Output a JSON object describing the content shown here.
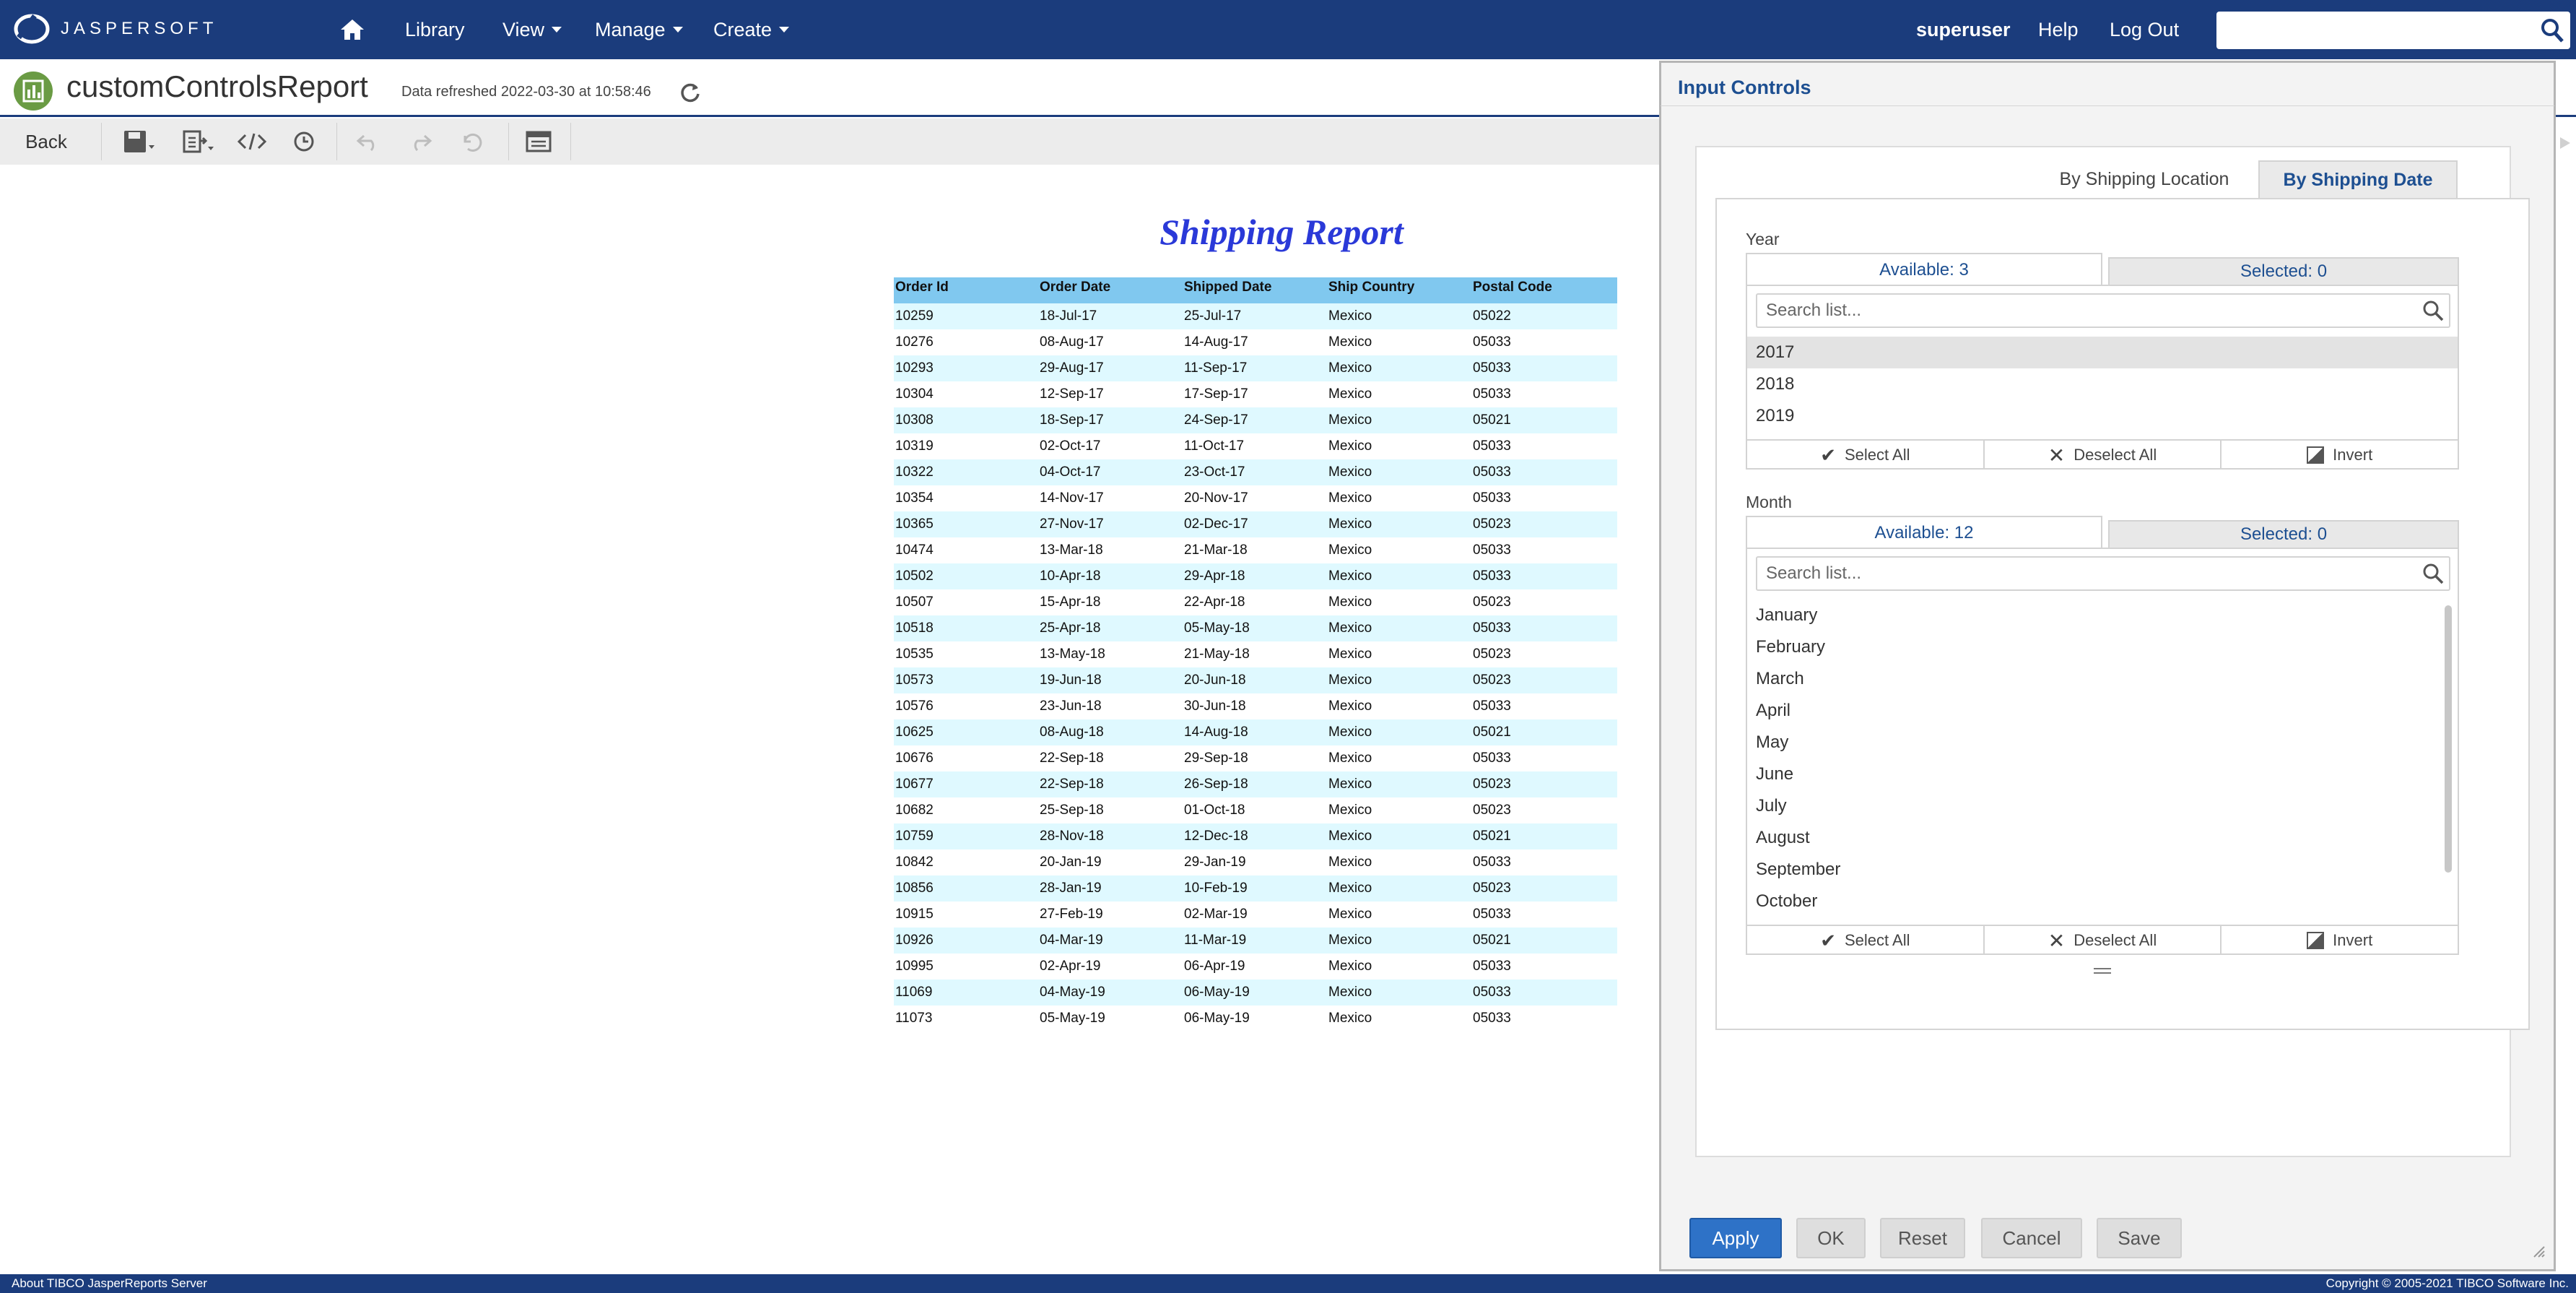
{
  "header": {
    "logo_text": "JASPERSOFT",
    "nav": {
      "library": "Library",
      "view": "View",
      "manage": "Manage",
      "create": "Create"
    },
    "user": "superuser",
    "help": "Help",
    "logout": "Log Out",
    "search_value": ""
  },
  "titlebar": {
    "report_name": "customControlsReport",
    "refresh_text": "Data refreshed 2022-03-30 at 10:58:46"
  },
  "toolbar": {
    "back": "Back"
  },
  "report": {
    "title": "Shipping Report",
    "columns": [
      "Order Id",
      "Order Date",
      "Shipped Date",
      "Ship Country",
      "Postal Code"
    ],
    "rows": [
      [
        "10259",
        "18-Jul-17",
        "25-Jul-17",
        "Mexico",
        "05022"
      ],
      [
        "10276",
        "08-Aug-17",
        "14-Aug-17",
        "Mexico",
        "05033"
      ],
      [
        "10293",
        "29-Aug-17",
        "11-Sep-17",
        "Mexico",
        "05033"
      ],
      [
        "10304",
        "12-Sep-17",
        "17-Sep-17",
        "Mexico",
        "05033"
      ],
      [
        "10308",
        "18-Sep-17",
        "24-Sep-17",
        "Mexico",
        "05021"
      ],
      [
        "10319",
        "02-Oct-17",
        "11-Oct-17",
        "Mexico",
        "05033"
      ],
      [
        "10322",
        "04-Oct-17",
        "23-Oct-17",
        "Mexico",
        "05033"
      ],
      [
        "10354",
        "14-Nov-17",
        "20-Nov-17",
        "Mexico",
        "05033"
      ],
      [
        "10365",
        "27-Nov-17",
        "02-Dec-17",
        "Mexico",
        "05023"
      ],
      [
        "10474",
        "13-Mar-18",
        "21-Mar-18",
        "Mexico",
        "05033"
      ],
      [
        "10502",
        "10-Apr-18",
        "29-Apr-18",
        "Mexico",
        "05033"
      ],
      [
        "10507",
        "15-Apr-18",
        "22-Apr-18",
        "Mexico",
        "05023"
      ],
      [
        "10518",
        "25-Apr-18",
        "05-May-18",
        "Mexico",
        "05033"
      ],
      [
        "10535",
        "13-May-18",
        "21-May-18",
        "Mexico",
        "05023"
      ],
      [
        "10573",
        "19-Jun-18",
        "20-Jun-18",
        "Mexico",
        "05023"
      ],
      [
        "10576",
        "23-Jun-18",
        "30-Jun-18",
        "Mexico",
        "05033"
      ],
      [
        "10625",
        "08-Aug-18",
        "14-Aug-18",
        "Mexico",
        "05021"
      ],
      [
        "10676",
        "22-Sep-18",
        "29-Sep-18",
        "Mexico",
        "05033"
      ],
      [
        "10677",
        "22-Sep-18",
        "26-Sep-18",
        "Mexico",
        "05023"
      ],
      [
        "10682",
        "25-Sep-18",
        "01-Oct-18",
        "Mexico",
        "05023"
      ],
      [
        "10759",
        "28-Nov-18",
        "12-Dec-18",
        "Mexico",
        "05021"
      ],
      [
        "10842",
        "20-Jan-19",
        "29-Jan-19",
        "Mexico",
        "05033"
      ],
      [
        "10856",
        "28-Jan-19",
        "10-Feb-19",
        "Mexico",
        "05023"
      ],
      [
        "10915",
        "27-Feb-19",
        "02-Mar-19",
        "Mexico",
        "05033"
      ],
      [
        "10926",
        "04-Mar-19",
        "11-Mar-19",
        "Mexico",
        "05021"
      ],
      [
        "10995",
        "02-Apr-19",
        "06-Apr-19",
        "Mexico",
        "05033"
      ],
      [
        "11069",
        "04-May-19",
        "06-May-19",
        "Mexico",
        "05033"
      ],
      [
        "11073",
        "05-May-19",
        "06-May-19",
        "Mexico",
        "05033"
      ]
    ]
  },
  "panel": {
    "title": "Input Controls",
    "tabs": [
      "By Shipping Location",
      "By Shipping Date"
    ],
    "active_tab": "By Shipping Date",
    "year": {
      "label": "Year",
      "available": "Available: 3",
      "selected": "Selected: 0",
      "search_placeholder": "Search list...",
      "items": [
        "2017",
        "2018",
        "2019"
      ]
    },
    "month": {
      "label": "Month",
      "available": "Available: 12",
      "selected": "Selected: 0",
      "search_placeholder": "Search list...",
      "items": [
        "January",
        "February",
        "March",
        "April",
        "May",
        "June",
        "July",
        "August",
        "September",
        "October"
      ]
    },
    "list_actions": {
      "select_all": "Select All",
      "deselect_all": "Deselect All",
      "invert": "Invert"
    },
    "buttons": {
      "apply": "Apply",
      "ok": "OK",
      "reset": "Reset",
      "cancel": "Cancel",
      "save": "Save"
    }
  },
  "footer": {
    "left": "About TIBCO JasperReports Server",
    "right": "Copyright © 2005-2021 TIBCO Software Inc."
  },
  "colors": {
    "brand_navy": "#1b3c7c",
    "report_title_blue": "#2a39d8",
    "table_header": "#80c8ef",
    "table_stripe": "#dff9ff",
    "apply_blue": "#2e72c7"
  }
}
